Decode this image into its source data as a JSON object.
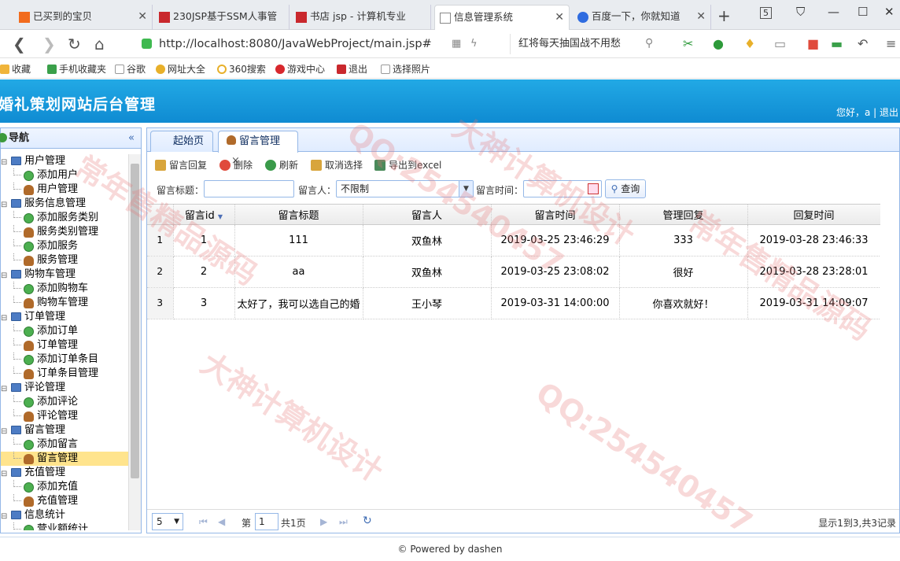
{
  "browser": {
    "tabs": [
      {
        "title": "已买到的宝贝",
        "active": false
      },
      {
        "title": "230JSP基于SSM人事管",
        "active": false
      },
      {
        "title": "书店 jsp - 计算机专业",
        "active": false
      },
      {
        "title": "信息管理系统",
        "active": true
      },
      {
        "title": "百度一下，你就知道",
        "active": false
      }
    ],
    "tab_count": "5",
    "url": "http://localhost:8080/JavaWebProject/main.jsp#",
    "search_text": "红将每天抽国战不用愁",
    "bookmarks": [
      "收藏",
      "手机收藏夹",
      "谷歌",
      "网址大全",
      "360搜索",
      "游戏中心",
      "退出",
      "选择照片"
    ]
  },
  "header": {
    "site_title": "婚礼策划网站后台管理",
    "greeting": "您好，a | 退出"
  },
  "nav": {
    "title": "导航",
    "tree": [
      {
        "type": "grp",
        "label": "用户管理"
      },
      {
        "type": "add",
        "label": "添加用户"
      },
      {
        "type": "mgr",
        "label": "用户管理"
      },
      {
        "type": "grp",
        "label": "服务信息管理"
      },
      {
        "type": "add",
        "label": "添加服务类别"
      },
      {
        "type": "mgr",
        "label": "服务类别管理"
      },
      {
        "type": "add",
        "label": "添加服务"
      },
      {
        "type": "mgr",
        "label": "服务管理"
      },
      {
        "type": "grp",
        "label": "购物车管理"
      },
      {
        "type": "add",
        "label": "添加购物车"
      },
      {
        "type": "mgr",
        "label": "购物车管理"
      },
      {
        "type": "grp",
        "label": "订单管理"
      },
      {
        "type": "add",
        "label": "添加订单"
      },
      {
        "type": "mgr",
        "label": "订单管理"
      },
      {
        "type": "add",
        "label": "添加订单条目"
      },
      {
        "type": "mgr",
        "label": "订单条目管理"
      },
      {
        "type": "grp",
        "label": "评论管理"
      },
      {
        "type": "add",
        "label": "添加评论"
      },
      {
        "type": "mgr",
        "label": "评论管理"
      },
      {
        "type": "grp",
        "label": "留言管理"
      },
      {
        "type": "add",
        "label": "添加留言"
      },
      {
        "type": "mgr",
        "label": "留言管理",
        "selected": true
      },
      {
        "type": "grp",
        "label": "充值管理"
      },
      {
        "type": "add",
        "label": "添加充值"
      },
      {
        "type": "mgr",
        "label": "充值管理"
      },
      {
        "type": "grp",
        "label": "信息统计"
      },
      {
        "type": "add",
        "label": "营业额统计"
      }
    ]
  },
  "main": {
    "tabs": [
      {
        "label": "起始页"
      },
      {
        "label": "留言管理",
        "close": "×"
      }
    ],
    "toolbar": [
      {
        "label": "留言回复",
        "icon": "edit-icon",
        "color": "#d8a53c"
      },
      {
        "label": "删除",
        "icon": "delete-icon",
        "color": "#e04b3c"
      },
      {
        "label": "刷新",
        "icon": "refresh-icon",
        "color": "#3a9a4a"
      },
      {
        "label": "取消选择",
        "icon": "undo-icon",
        "color": "#d8a53c"
      },
      {
        "label": "导出到excel",
        "icon": "export-icon",
        "color": "#4a8a5a"
      }
    ],
    "filters": {
      "title_label": "留言标题：",
      "person_label": "留言人：",
      "person_value": "不限制",
      "time_label": "留言时间：",
      "query_label": "查询"
    },
    "columns": [
      "留言id",
      "留言标题",
      "留言人",
      "留言时间",
      "管理回复",
      "回复时间"
    ],
    "rows": [
      {
        "rn": "1",
        "id": "1",
        "title": "111",
        "person": "双鱼林",
        "time": "2019-03-25 23:46:29",
        "reply": "333",
        "reply_time": "2019-03-28 23:46:33"
      },
      {
        "rn": "2",
        "id": "2",
        "title": "aa",
        "person": "双鱼林",
        "time": "2019-03-25 23:08:02",
        "reply": "很好",
        "reply_time": "2019-03-28 23:28:01"
      },
      {
        "rn": "3",
        "id": "3",
        "title": "太好了，我可以选自己的婚",
        "person": "王小琴",
        "time": "2019-03-31 14:00:00",
        "reply": "你喜欢就好！",
        "reply_time": "2019-03-31 14:09:07"
      }
    ],
    "pager": {
      "page_size": "5",
      "page_prefix": "第",
      "page_value": "1",
      "page_total": "共1页",
      "summary": "显示1到3,共3记录"
    }
  },
  "footer": "© Powered by dashen",
  "watermarks": [
    "QQ:254540457",
    "大神计算机设计",
    "常年售精品源码"
  ]
}
